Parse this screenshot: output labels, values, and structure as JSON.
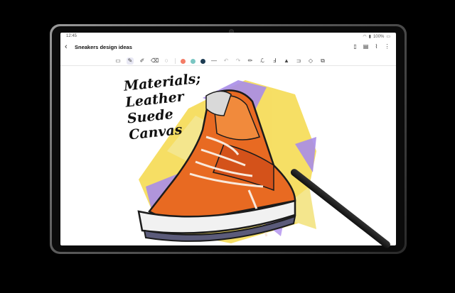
{
  "status": {
    "time": "12:45",
    "battery": "100%"
  },
  "app": {
    "title": "Sneakers design ideas",
    "back_icon": "back-arrow-icon"
  },
  "app_icons": [
    "book-icon",
    "page-icon",
    "attach-icon",
    "more-icon"
  ],
  "toolbar": {
    "tools": [
      "text-icon",
      "pen-icon",
      "highlighter-icon",
      "eraser-icon",
      "lasso-icon"
    ],
    "colors": [
      "#f47c66",
      "#7ac6c2",
      "#1c3b52"
    ],
    "actions": [
      "undo-icon",
      "redo-icon",
      "pencil-icon",
      "handwriting-icon",
      "text-convert-icon",
      "fill-icon",
      "insert-icon",
      "shape-icon",
      "copy-icon"
    ]
  },
  "note": {
    "lines": [
      "Materials;",
      "Leather",
      "Suede",
      "Canvas"
    ]
  }
}
